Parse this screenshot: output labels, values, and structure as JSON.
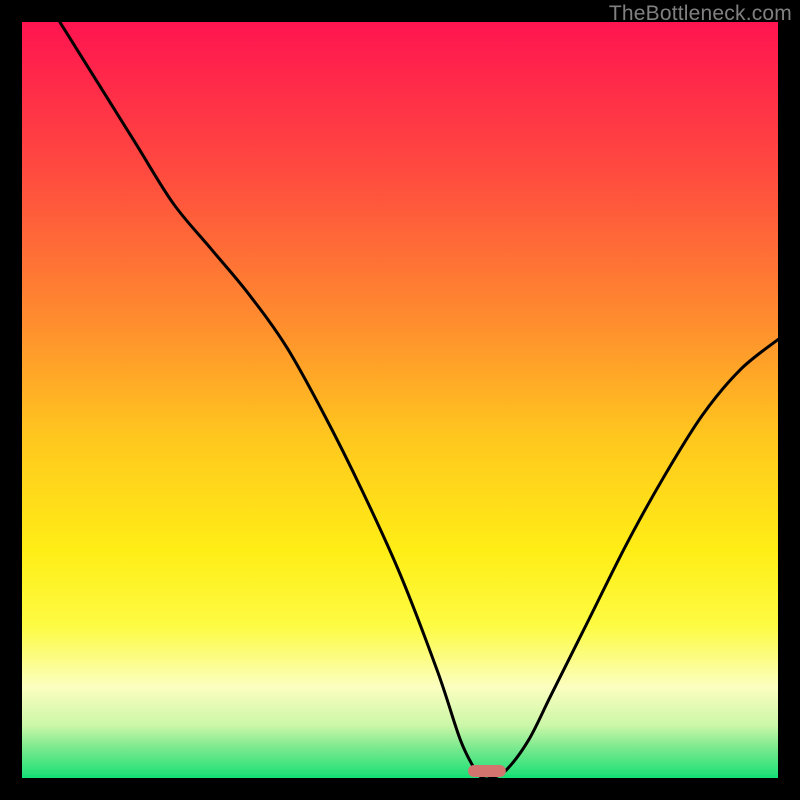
{
  "watermark": "TheBottleneck.com",
  "chart_data": {
    "type": "line",
    "title": "",
    "xlabel": "",
    "ylabel": "",
    "xlim": [
      0,
      100
    ],
    "ylim": [
      0,
      100
    ],
    "grid": false,
    "series": [
      {
        "name": "bottleneck-curve",
        "x": [
          5,
          10,
          15,
          20,
          25,
          30,
          35,
          40,
          45,
          50,
          55,
          58,
          60,
          61,
          62,
          64,
          67,
          70,
          75,
          80,
          85,
          90,
          95,
          100
        ],
        "y": [
          100,
          92,
          84,
          76,
          70,
          64,
          57,
          48,
          38,
          27,
          14,
          5,
          1,
          0,
          0,
          1,
          5,
          11,
          21,
          31,
          40,
          48,
          54,
          58
        ]
      }
    ],
    "marker": {
      "name": "optimal-zone",
      "x_center": 61.5,
      "y": 0,
      "width": 5,
      "color": "#d4746f"
    },
    "background_gradient": {
      "stops": [
        {
          "offset": 0.0,
          "color": "#ff1450"
        },
        {
          "offset": 0.2,
          "color": "#ff4b3f"
        },
        {
          "offset": 0.4,
          "color": "#ff8e2e"
        },
        {
          "offset": 0.55,
          "color": "#ffc71e"
        },
        {
          "offset": 0.7,
          "color": "#ffee16"
        },
        {
          "offset": 0.8,
          "color": "#fdfb44"
        },
        {
          "offset": 0.88,
          "color": "#fbfec0"
        },
        {
          "offset": 0.93,
          "color": "#ccf7a8"
        },
        {
          "offset": 0.96,
          "color": "#7be98f"
        },
        {
          "offset": 1.0,
          "color": "#17e074"
        }
      ]
    }
  }
}
